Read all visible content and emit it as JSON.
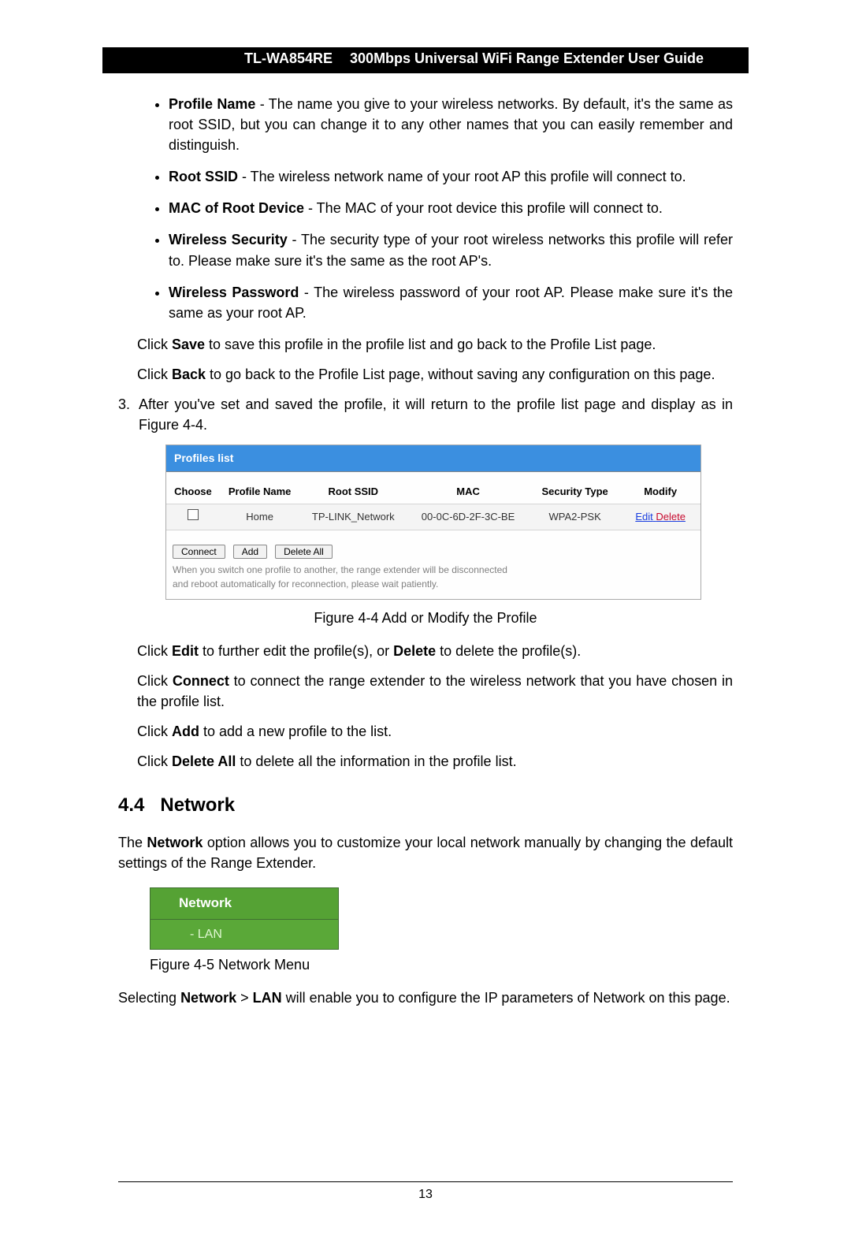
{
  "header": {
    "model": "TL-WA854RE",
    "title": "300Mbps Universal WiFi Range Extender User Guide"
  },
  "bullets": [
    {
      "label": "Profile Name",
      "text": " - The name you give to your wireless networks. By default, it's the same as root SSID, but you can change it to any other names that you can easily remember and distinguish."
    },
    {
      "label": "Root SSID",
      "text": " - The wireless network name of your root AP this profile will connect to."
    },
    {
      "label": "MAC of Root Device",
      "text": " - The MAC of your root device this profile will connect to."
    },
    {
      "label": "Wireless Security",
      "text": " - The security type of your root wireless networks this profile will refer to. Please make sure it's the same as the root AP's."
    },
    {
      "label": "Wireless Password",
      "text": " - The wireless password of your root AP. Please make sure it's the same as your root AP."
    }
  ],
  "save_line": {
    "pre": "Click ",
    "b": "Save",
    "post": " to save this profile in the profile list and go back to the Profile List page."
  },
  "back_line": {
    "pre": "Click ",
    "b": "Back",
    "post": " to go back to the Profile List page, without saving any configuration on this page."
  },
  "step3": {
    "num": "3.",
    "pre": "After you've set and saved the profile, it will return to the profile list page and display as in Figure 4-4."
  },
  "profiles": {
    "title": "Profiles list",
    "headers": {
      "choose": "Choose",
      "profile": "Profile Name",
      "ssid": "Root SSID",
      "mac": "MAC",
      "sec": "Security Type",
      "modify": "Modify"
    },
    "row": {
      "profile": "Home",
      "ssid": "TP-LINK_Network",
      "mac": "00-0C-6D-2F-3C-BE",
      "sec": "WPA2-PSK",
      "edit": "Edit",
      "delete": "Delete"
    },
    "buttons": {
      "connect": "Connect",
      "add": "Add",
      "delall": "Delete All"
    },
    "hint1": "When you switch one profile to another, the range extender will be disconnected",
    "hint2": "and reboot automatically for reconnection, please wait patiently."
  },
  "fig44": "Figure 4-4 Add or Modify the Profile",
  "edit_line": {
    "pre": "Click ",
    "b1": "Edit",
    "mid": " to further edit the profile(s), or ",
    "b2": "Delete",
    "post": " to delete the profile(s)."
  },
  "connect_line": {
    "pre": "Click ",
    "b": "Connect",
    "post": " to connect the range extender to the wireless network that you have chosen in the profile list."
  },
  "add_line": {
    "pre": "Click ",
    "b": "Add",
    "post": " to add a new profile to the list."
  },
  "delall_line": {
    "pre": "Click ",
    "b": "Delete All",
    "post": " to delete all the information in the profile list."
  },
  "section": {
    "num": "4.4",
    "title": "Network"
  },
  "section_body": {
    "pre": "The ",
    "b": "Network",
    "post": " option allows you to customize your local network manually by changing the default settings of the Range Extender."
  },
  "netmenu": {
    "hdr": "Network",
    "item": "- LAN"
  },
  "fig45": "Figure 4-5 Network Menu",
  "selecting": {
    "pre": "Selecting ",
    "b1": "Network",
    "gt": " > ",
    "b2": "LAN",
    "post": " will enable you to configure the IP parameters of Network on this page."
  },
  "page_num": "13"
}
